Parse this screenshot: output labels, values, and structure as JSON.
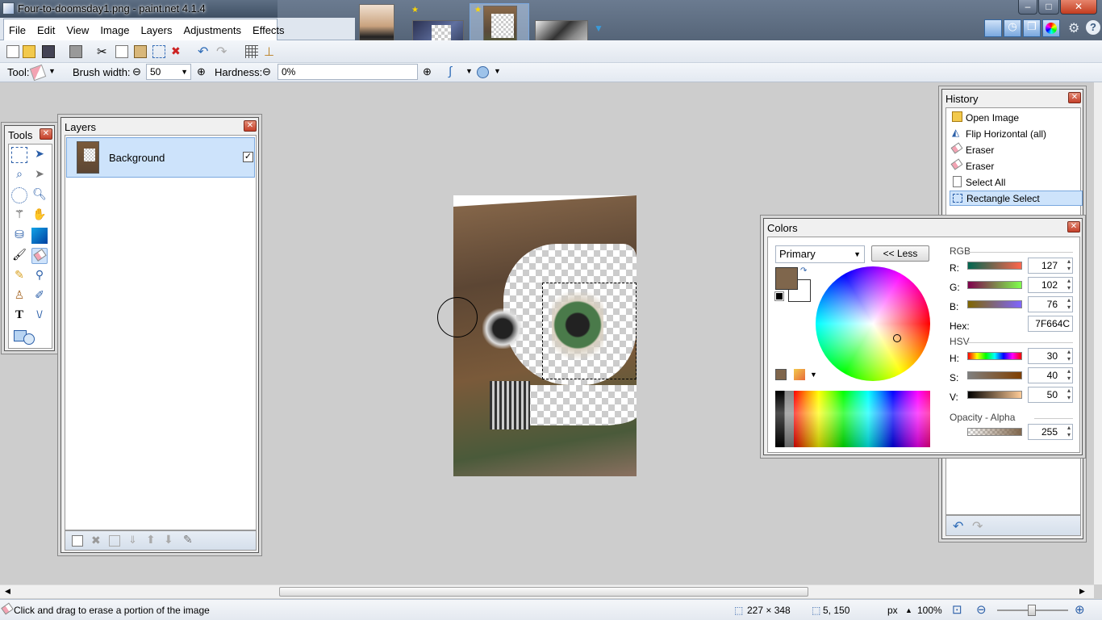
{
  "window": {
    "title": "Four-to-doomsday1.png - paint.net 4.1.4",
    "controls": {
      "minimize": "–",
      "maximize": "□",
      "close": "✕"
    }
  },
  "menu": [
    "File",
    "Edit",
    "View",
    "Image",
    "Layers",
    "Adjustments",
    "Effects"
  ],
  "toolbar": {
    "tool_label": "Tool:",
    "brush_width_label": "Brush width:",
    "brush_width_value": "50",
    "hardness_label": "Hardness:",
    "hardness_value": "0%"
  },
  "tools_panel": {
    "title": "Tools",
    "close": "✕"
  },
  "layers_panel": {
    "title": "Layers",
    "close": "✕",
    "layers": [
      {
        "name": "Background",
        "visible": true
      }
    ]
  },
  "history_panel": {
    "title": "History",
    "close": "✕",
    "items": [
      {
        "label": "Open Image",
        "icon": "folder-icon"
      },
      {
        "label": "Flip Horizontal (all)",
        "icon": "flip-icon"
      },
      {
        "label": "Eraser",
        "icon": "eraser-icon"
      },
      {
        "label": "Eraser",
        "icon": "eraser-icon"
      },
      {
        "label": "Select All",
        "icon": "page-icon"
      },
      {
        "label": "Rectangle Select",
        "icon": "rect-select-icon"
      }
    ],
    "selected_index": 5
  },
  "colors_panel": {
    "title": "Colors",
    "close": "✕",
    "mode": "Primary",
    "less_button": "<< Less",
    "primary_color": "#7F664C",
    "secondary_color": "#FFFFFF",
    "rgb_label": "RGB",
    "r_label": "R:",
    "r": "127",
    "g_label": "G:",
    "g": "102",
    "b_label": "B:",
    "b": "76",
    "hex_label": "Hex:",
    "hex": "7F664C",
    "hsv_label": "HSV",
    "h_label": "H:",
    "h": "30",
    "s_label": "S:",
    "s": "40",
    "v_label": "V:",
    "v": "50",
    "opacity_label": "Opacity - Alpha",
    "alpha": "255"
  },
  "status": {
    "hint": "Click and drag to erase a portion of the image",
    "image_size": "227 × 348",
    "cursor_pos": "5, 150",
    "unit": "px",
    "zoom": "100%"
  }
}
